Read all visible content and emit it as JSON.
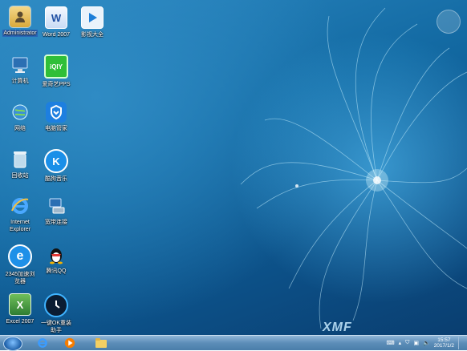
{
  "desktop_icons": {
    "administrator": "Administrator",
    "word": "Word 2007",
    "video": "影视大全",
    "computer": "计算机",
    "iqiyi": "爱奇艺PPS",
    "network": "网络",
    "pcmanager": "电脑管家",
    "recycle": "回收站",
    "kugou": "酷狗音乐",
    "broadband": "宽带连接",
    "ie_line1": "Internet",
    "ie_line2": "Explorer",
    "browser_line1": "2345加速浏",
    "browser_line2": "览器",
    "qq": "腾讯QQ",
    "excel": "Excel 2007",
    "reinstall_line1": "一键OK重装",
    "reinstall_line2": "助手"
  },
  "icon_glyphs": {
    "word": "W",
    "iqiyi": "iQIY",
    "kugou": "K",
    "browser": "e",
    "excel": "X"
  },
  "icons": {
    "administrator": "user-folder-icon",
    "word": "word-icon",
    "video": "video-player-icon",
    "computer": "computer-icon",
    "iqiyi": "iqiyi-icon",
    "network": "network-globe-icon",
    "pcmanager": "shield-icon",
    "recycle": "recycle-bin-icon",
    "kugou": "kugou-music-icon",
    "broadband": "broadband-connection-icon",
    "ie": "internet-explorer-icon",
    "browser": "browser-2345-icon",
    "qq": "penguin-icon",
    "excel": "excel-icon",
    "reinstall": "reinstall-tool-icon"
  },
  "wallpaper_logo": "XMF",
  "taskbar": {
    "clock_time": "15:57",
    "clock_date": "2017/1/2"
  },
  "colors": {
    "desktop_blue": "#136aa3",
    "taskbar_blue": "#5c8db8",
    "selection": "#2a66b8"
  }
}
